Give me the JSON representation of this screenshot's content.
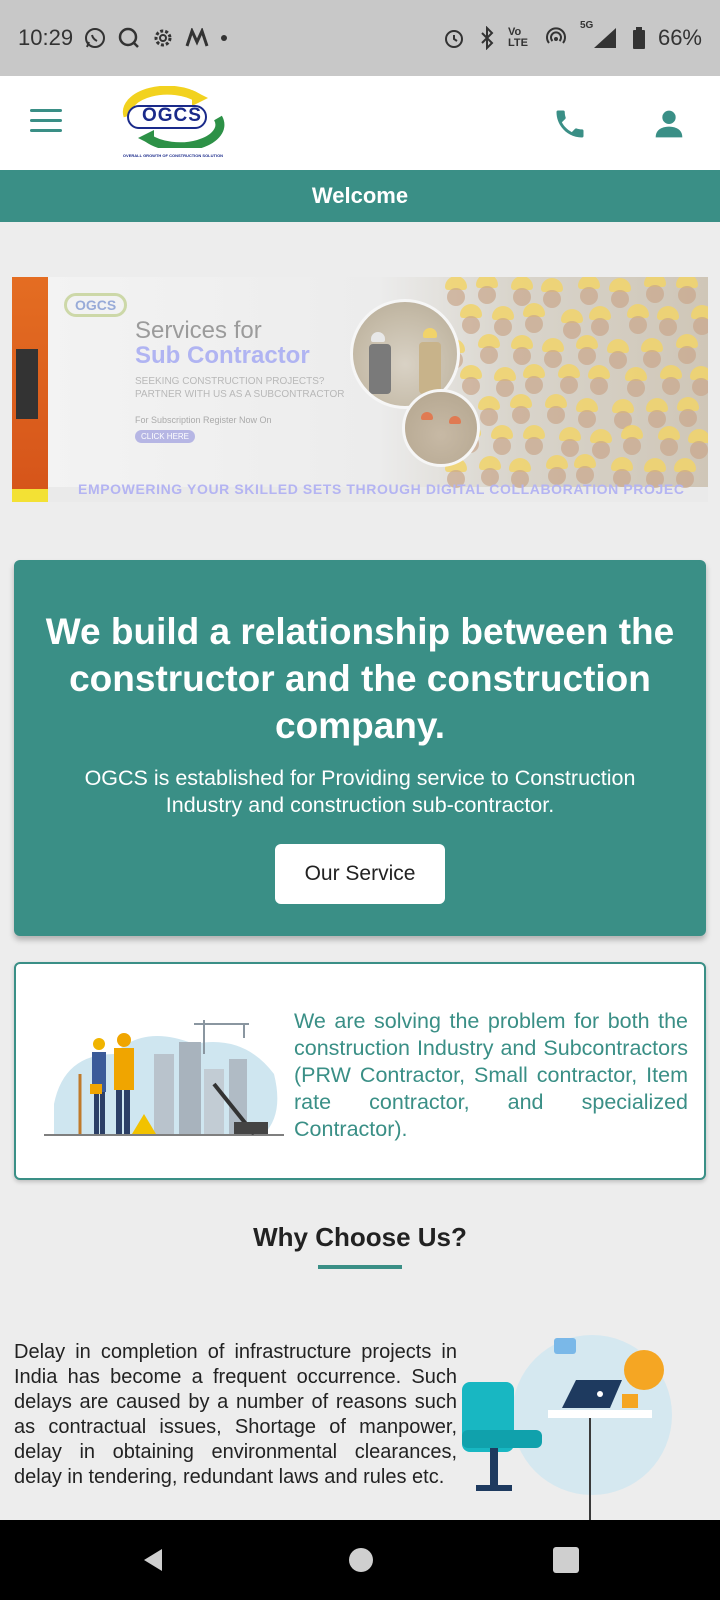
{
  "status_bar": {
    "time": "10:29",
    "battery": "66%",
    "network": "5G",
    "volte": "Vo LTE"
  },
  "header": {
    "logo_text": "OGCS",
    "logo_subtext": "OVERALL GROWTH OF CONSTRUCTION SOLUTION"
  },
  "welcome": "Welcome",
  "banner": {
    "logo": "OGCS",
    "title_line1": "Services for",
    "title_line2": "Sub Contractor",
    "subtitle_line1": "SEEKING CONSTRUCTION PROJECTS?",
    "subtitle_line2": "PARTNER WITH US AS A SUBCONTRACTOR",
    "register": "For Subscription Register Now On",
    "click_here": "CLICK HERE",
    "marquee": "EMPOWERING YOUR SKILLED SETS THROUGH DIGITAL COLLABORATION PROJEC"
  },
  "hero": {
    "heading": "We build a relationship between the constructor and the construction company.",
    "description": "OGCS is established for Providing service to Construction Industry and construction sub-contractor.",
    "button_label": "Our Service"
  },
  "info": {
    "text": "We are solving the problem for both the construction Industry and Subcontractors (PRW Contractor, Small contractor, Item rate contractor, and specialized Contractor)."
  },
  "why": {
    "title": "Why Choose Us?",
    "text": "Delay in completion of infrastructure projects in India has become a frequent occurrence. Such delays are caused by a number of reasons such as contractual issues, Shortage of manpower, delay in obtaining environmental clearances, delay in tendering, redundant laws and rules etc."
  },
  "colors": {
    "brand": "#3a8f86",
    "status_bar": "#c8c8c8",
    "page_bg": "#ededed"
  },
  "icons": [
    "whatsapp-icon",
    "chat-icon",
    "settings-icon",
    "maps-icon",
    "alarm-icon",
    "bluetooth-icon",
    "hotspot-icon",
    "signal-icon",
    "battery-icon",
    "menu-icon",
    "phone-icon",
    "user-icon",
    "back-icon",
    "home-icon",
    "recents-icon"
  ]
}
